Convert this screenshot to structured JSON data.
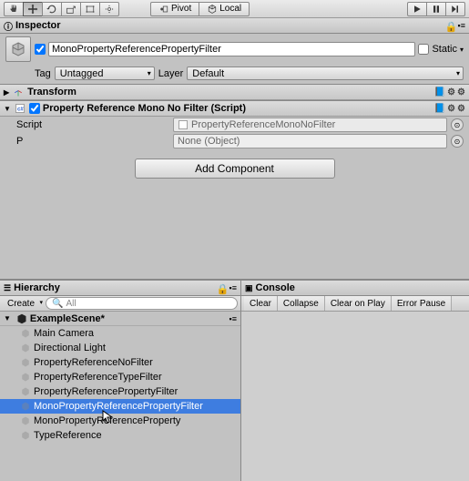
{
  "toolbar": {
    "pivot": "Pivot",
    "local": "Local"
  },
  "inspector": {
    "tab": "Inspector",
    "go_name": "MonoPropertyReferencePropertyFilter",
    "static_label": "Static",
    "tag_label": "Tag",
    "tag_value": "Untagged",
    "layer_label": "Layer",
    "layer_value": "Default"
  },
  "transform": {
    "title": "Transform"
  },
  "script_comp": {
    "title": "Property Reference Mono No Filter (Script)",
    "script_label": "Script",
    "script_value": "PropertyReferenceMonoNoFilter",
    "p_label": "P",
    "p_value": "None (Object)"
  },
  "add_component": "Add Component",
  "hierarchy": {
    "tab": "Hierarchy",
    "create": "Create",
    "search_placeholder": "All",
    "scene": "ExampleScene*",
    "items": [
      "Main Camera",
      "Directional Light",
      "PropertyReferenceNoFilter",
      "PropertyReferenceTypeFilter",
      "PropertyReferencePropertyFilter",
      "MonoPropertyReferencePropertyFilter",
      "MonoPropertyReferenceProperty",
      "TypeReference"
    ],
    "selected_index": 5
  },
  "console": {
    "tab": "Console",
    "clear": "Clear",
    "collapse": "Collapse",
    "clear_on_play": "Clear on Play",
    "error_pause": "Error Pause"
  }
}
